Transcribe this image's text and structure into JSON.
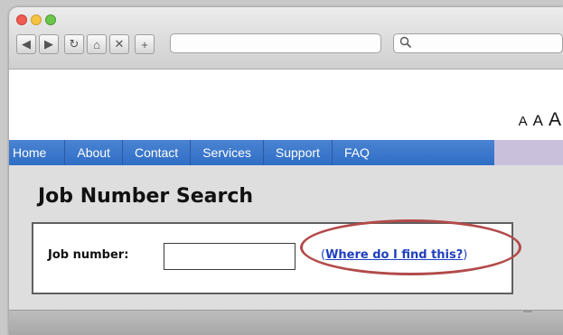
{
  "window": {
    "traffic_lights": [
      "close",
      "minimize",
      "zoom"
    ],
    "nav_buttons": [
      {
        "name": "back-icon",
        "glyph": "◀"
      },
      {
        "name": "forward-icon",
        "glyph": "▶"
      },
      {
        "name": "reload-icon",
        "glyph": "↻"
      },
      {
        "name": "home-icon",
        "glyph": "⌂"
      },
      {
        "name": "close-icon",
        "glyph": "✕"
      },
      {
        "name": "add-tab-icon",
        "glyph": "+"
      }
    ],
    "address_value": "",
    "search_icon": "search-icon",
    "search_glyph": "⚲"
  },
  "page": {
    "text_size": {
      "small": "A",
      "medium": "A",
      "large": "A"
    },
    "menu": [
      {
        "label": "Home"
      },
      {
        "label": "About"
      },
      {
        "label": "Contact"
      },
      {
        "label": "Services"
      },
      {
        "label": "Support"
      },
      {
        "label": "FAQ"
      }
    ],
    "heading": "Job Number Search",
    "form": {
      "job_label": "Job number:",
      "job_value": "",
      "help_open": "(",
      "help_link": "Where do I find this?",
      "help_close": ")"
    }
  },
  "colors": {
    "menu_bar": "#2f6ec6",
    "highlight": "#b34a4a",
    "link": "#1f3fbf"
  }
}
